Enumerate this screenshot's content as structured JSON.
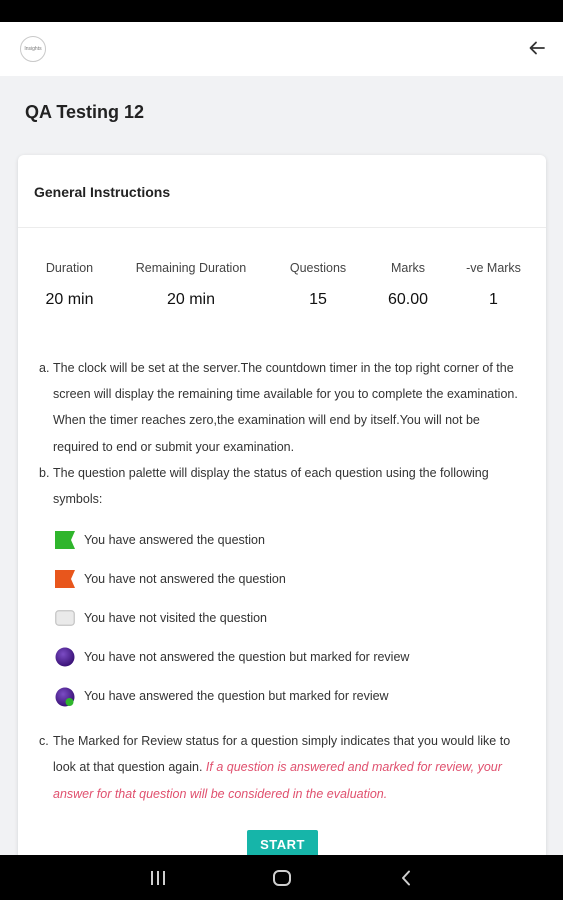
{
  "app": {
    "logo_text": "Insights",
    "back_icon": "arrow-left-icon"
  },
  "page": {
    "title": "QA Testing 12"
  },
  "card": {
    "header": "General Instructions",
    "stats": [
      {
        "label": "Duration",
        "value": "20 min"
      },
      {
        "label": "Remaining Duration",
        "value": "20 min"
      },
      {
        "label": "Questions",
        "value": "15"
      },
      {
        "label": "Marks",
        "value": "60.00"
      },
      {
        "label": "-ve Marks",
        "value": "1"
      }
    ],
    "instructions": {
      "a_marker": "a.",
      "a_text": "The clock will be set at the server.The countdown timer in the top right corner of the screen will display the remaining time available for you to complete the examination. When the timer reaches zero,the examination will end by itself.You will not be required to end or submit your examination.",
      "b_marker": "b.",
      "b_text": "The question palette will display the status of each question using the following symbols:",
      "legend": [
        {
          "icon": "green-flag-icon",
          "color": "#2fb52c",
          "text": "You have answered the question"
        },
        {
          "icon": "orange-flag-icon",
          "color": "#e8561c",
          "text": "You have not answered the question"
        },
        {
          "icon": "grey-box-icon",
          "color": "#e6e6e6",
          "text": "You have not visited the question"
        },
        {
          "icon": "purple-circle-icon",
          "color": "#4b2093",
          "text": "You have not answered the question but marked for review"
        },
        {
          "icon": "purple-circle-with-check-icon",
          "color": "#4b2093",
          "text": "You have answered the question but marked for review"
        }
      ],
      "c_marker": "c.",
      "c_text": "The Marked for Review status for a question simply indicates that you would like to look at that question again.",
      "c_italic": "If a question is answered and marked for review, your answer for that question will be considered in the evaluation."
    },
    "start_label": "START"
  },
  "colors": {
    "accent": "#16b5a9",
    "warning_text": "#e0506e"
  },
  "nav": {
    "recents_icon": "recent-apps-icon",
    "home_icon": "home-icon",
    "back_icon": "system-back-icon"
  }
}
